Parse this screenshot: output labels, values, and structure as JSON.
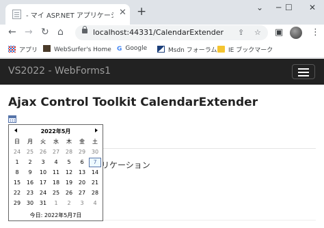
{
  "browser": {
    "tab_title": "- マイ ASP.NET アプリケーション",
    "tab_close": "✕",
    "new_tab": "+",
    "window_controls": {
      "minimize": "─",
      "maximize": "☐",
      "close": "✕"
    },
    "nav": {
      "back": "←",
      "forward": "→",
      "reload": "↻",
      "home": "⌂"
    },
    "url": "localhost:44331/CalendarExtender",
    "omnibox_icons": {
      "share": "⇪",
      "bookmark": "☆"
    },
    "toolbar_icons": {
      "side_panel": "▣",
      "menu": "⋮"
    },
    "bookmarks": [
      {
        "label": "アプリ",
        "icon": "apps-grid-icon"
      },
      {
        "label": "WebSurfer's Home",
        "icon": "websurfer-icon"
      },
      {
        "label": "Google",
        "icon": "google-icon"
      },
      {
        "label": "Msdn フォーラム",
        "icon": "msdn-icon"
      },
      {
        "label": "IE ブックマーク",
        "icon": "folder-icon"
      }
    ]
  },
  "site": {
    "brand": "VS2022 - WebForms1"
  },
  "page": {
    "title": "Ajax Control Toolkit CalendarExtender",
    "body_text": "リケーション"
  },
  "calendar": {
    "title": "2022年5月",
    "weekdays": [
      "日",
      "月",
      "火",
      "水",
      "木",
      "金",
      "土"
    ],
    "weeks": [
      [
        "24",
        "25",
        "26",
        "27",
        "28",
        "29",
        "30"
      ],
      [
        "1",
        "2",
        "3",
        "4",
        "5",
        "6",
        "7"
      ],
      [
        "8",
        "9",
        "10",
        "11",
        "12",
        "13",
        "14"
      ],
      [
        "15",
        "16",
        "17",
        "18",
        "19",
        "20",
        "21"
      ],
      [
        "22",
        "23",
        "24",
        "25",
        "26",
        "27",
        "28"
      ],
      [
        "29",
        "30",
        "31",
        "1",
        "2",
        "3",
        "4"
      ]
    ],
    "today_label": "今日: 2022年5月7日",
    "colors": {
      "selected_border": "#5573a8",
      "other_month": "#808080"
    }
  }
}
